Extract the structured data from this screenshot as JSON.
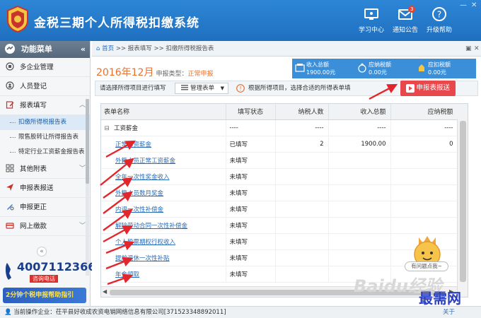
{
  "header": {
    "app_title": "金税三期个人所得税扣缴系统",
    "buttons": [
      {
        "label": "学习中心",
        "icon": "learning-center-icon"
      },
      {
        "label": "通知公告",
        "icon": "mail-icon",
        "badge": "3"
      },
      {
        "label": "升级帮助",
        "icon": "help-icon"
      }
    ]
  },
  "sidebar": {
    "title": "功能菜单",
    "items": [
      {
        "label": "多企业管理",
        "icon": "building-icon"
      },
      {
        "label": "人员登记",
        "icon": "person-icon"
      },
      {
        "label": "报表填写",
        "icon": "edit-icon"
      },
      {
        "label": "其他附表",
        "icon": "grid-icon"
      },
      {
        "label": "申报表报送",
        "icon": "send-icon"
      },
      {
        "label": "申报更正",
        "icon": "correct-icon"
      },
      {
        "label": "网上缴款",
        "icon": "payment-icon"
      }
    ],
    "sub_items": [
      {
        "label": "扣缴所得税报告表",
        "active": true
      },
      {
        "label": "限售股转让所得报告表",
        "active": false
      },
      {
        "label": "特定行业工资薪金报告表",
        "active": false
      }
    ],
    "hotline": {
      "number": "4007112366",
      "tag": "咨询电话"
    },
    "guide": "2分钟个税申报帮助指引"
  },
  "breadcrumb": {
    "home": "首页",
    "path": ">> 报表填写 >> 扣缴所得税报告表",
    "controls": [
      "▣",
      "✕"
    ]
  },
  "period": {
    "date": "2016年12月",
    "type_label": "申报类型：",
    "type_value": "正常申报"
  },
  "summary": [
    {
      "label": "收入总额",
      "value": "1900.00元",
      "icon": "income-icon"
    },
    {
      "label": "应纳税额",
      "value": "0.00元",
      "icon": "tax-icon"
    },
    {
      "label": "应扣税额",
      "value": "0.00元",
      "icon": "deduct-icon"
    }
  ],
  "toolbar": {
    "prompt": "请选择所得项目进行填写",
    "select_label": "管理表单",
    "hint": "根据所得项目，选择合适的所得表单填",
    "submit_label": "申报表报送"
  },
  "table": {
    "columns": [
      "表单名称",
      "填写状态",
      "纳税人数",
      "收入总额",
      "应纳税额"
    ],
    "group": {
      "label": "工资薪金",
      "status": "----",
      "count": "----",
      "income": "----",
      "tax": "----"
    },
    "rows": [
      {
        "name": "正常工资薪金",
        "status": "已填写",
        "count": "2",
        "income": "1900.00",
        "tax": "0"
      },
      {
        "name": "外籍人员正常工资薪金",
        "status": "未填写",
        "count": "",
        "income": "",
        "tax": ""
      },
      {
        "name": "全年一次性奖金收入",
        "status": "未填写",
        "count": "",
        "income": "",
        "tax": ""
      },
      {
        "name": "外籍人员数月奖金",
        "status": "未填写",
        "count": "",
        "income": "",
        "tax": ""
      },
      {
        "name": "内退一次性补偿金",
        "status": "未填写",
        "count": "",
        "income": "",
        "tax": ""
      },
      {
        "name": "解除劳动合同一次性补偿金",
        "status": "未填写",
        "count": "",
        "income": "",
        "tax": ""
      },
      {
        "name": "个人股票期权行权收入",
        "status": "未填写",
        "count": "",
        "income": "",
        "tax": ""
      },
      {
        "name": "提前退休一次性补贴",
        "status": "未填写",
        "count": "",
        "income": "",
        "tax": ""
      },
      {
        "name": "年金领取",
        "status": "未填写",
        "count": "",
        "income": "",
        "tax": ""
      }
    ]
  },
  "mascot": {
    "bubble": "有问题点我~"
  },
  "watermark": "Baidu经验",
  "site_tag": "最需网",
  "statusbar": {
    "company": "当前操作企业：茌平县好收成农资电销网络信息有限公司[371523348892011]",
    "about": "关于"
  },
  "colors": {
    "header_blue": "#2e86d6",
    "accent_orange": "#e8712e",
    "submit_red": "#e8474c",
    "link_blue": "#2a6db8",
    "arrow_red": "#e3262b"
  }
}
